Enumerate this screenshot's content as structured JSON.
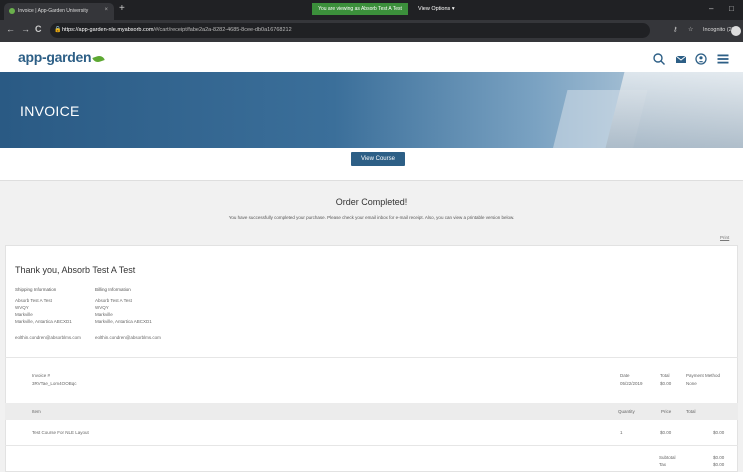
{
  "browser": {
    "tab_title": "Invoice | App-Garden University",
    "tab_close": "×",
    "new_tab": "+",
    "banner": "You are viewing as Absorb Test A Test",
    "view_options": "View Options ▾",
    "min": "–",
    "max": "□",
    "back": "←",
    "forward": "→",
    "reload": "C",
    "url_host": "https://app-garden-nle.myabsorb.com",
    "url_path": "/#/cart/receipt/fabe2a2a-8282-4685-8cee-db0a16768212",
    "incognito": "Incognito (2)"
  },
  "header": {
    "logo_text": "app-garden"
  },
  "hero": {
    "title": "INVOICE"
  },
  "actions": {
    "view_course": "View Course"
  },
  "order": {
    "title": "Order Completed!",
    "message": "You have successfully completed your purchase. Please check your email inbox for e-mail receipt. Also, you can view a printable version below.",
    "print": "Print"
  },
  "invoice": {
    "thanks": "Thank you, Absorb Test A Test",
    "shipping": {
      "heading": "Shipping Information",
      "lines": [
        "Absorb Test A Test",
        "WVQY",
        "Markville",
        "Markville, Antartica ABCXD1"
      ],
      "email": "eolthin.condren@absorblms.com"
    },
    "billing": {
      "heading": "Billing Information",
      "lines": [
        "Absorb Test A Test",
        "WVQY",
        "Markville",
        "Markville, Antartica ABCXD1"
      ],
      "email": "eolthin.condren@absorblms.com"
    },
    "meta": {
      "number_label": "Invoice #",
      "number": "3RVTae_Lom4OOBqc",
      "date_label": "Date",
      "date": "05/22/2019",
      "total_label": "Total",
      "total": "$0.00",
      "pm_label": "Payment Method",
      "pm": "None"
    },
    "columns": {
      "item": "Item",
      "quantity": "Quantity",
      "price": "Price",
      "total": "Total"
    },
    "items": [
      {
        "name": "Test Course For NLE Layout",
        "quantity": "1",
        "price": "$0.00",
        "total": "$0.00"
      }
    ],
    "summary": {
      "subtotal_label": "Subtotal",
      "subtotal": "$0.00",
      "tax_label": "Tax",
      "tax": "$0.00"
    }
  },
  "colors": {
    "brand_blue": "#2d5f86",
    "leaf_green": "#5da832"
  }
}
